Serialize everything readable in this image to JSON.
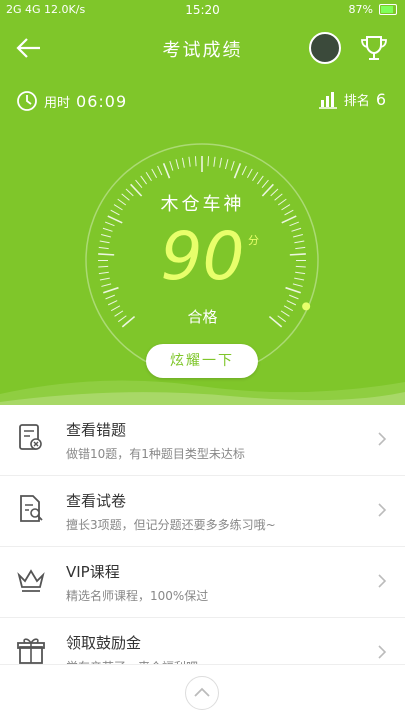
{
  "status_bar": {
    "signal": "2G 4G",
    "speed": "12.0K/s",
    "time": "15:20",
    "battery": "87%"
  },
  "header": {
    "title": "考试成绩"
  },
  "stats": {
    "time_label": "用时",
    "time_value": "06:09",
    "rank_label": "排名",
    "rank_value": "6"
  },
  "result": {
    "name": "木仓车神",
    "score": "90",
    "score_unit": "分",
    "grade": "合格",
    "share_label": "炫耀一下"
  },
  "menu": [
    {
      "title": "查看错题",
      "subtitle": "做错10题，有1种题目类型未达标",
      "icon": "wrong-questions-icon"
    },
    {
      "title": "查看试卷",
      "subtitle": "擅长3项题，但记分题还要多多练习哦~",
      "icon": "review-paper-icon"
    },
    {
      "title": "VIP课程",
      "subtitle": "精选名师课程，100%保过",
      "icon": "vip-crown-icon"
    },
    {
      "title": "领取鼓励金",
      "subtitle": "学车辛苦了，来个福利吧",
      "icon": "gift-icon"
    }
  ],
  "colors": {
    "primary": "#7fc62a",
    "score": "#e8ff6b"
  }
}
